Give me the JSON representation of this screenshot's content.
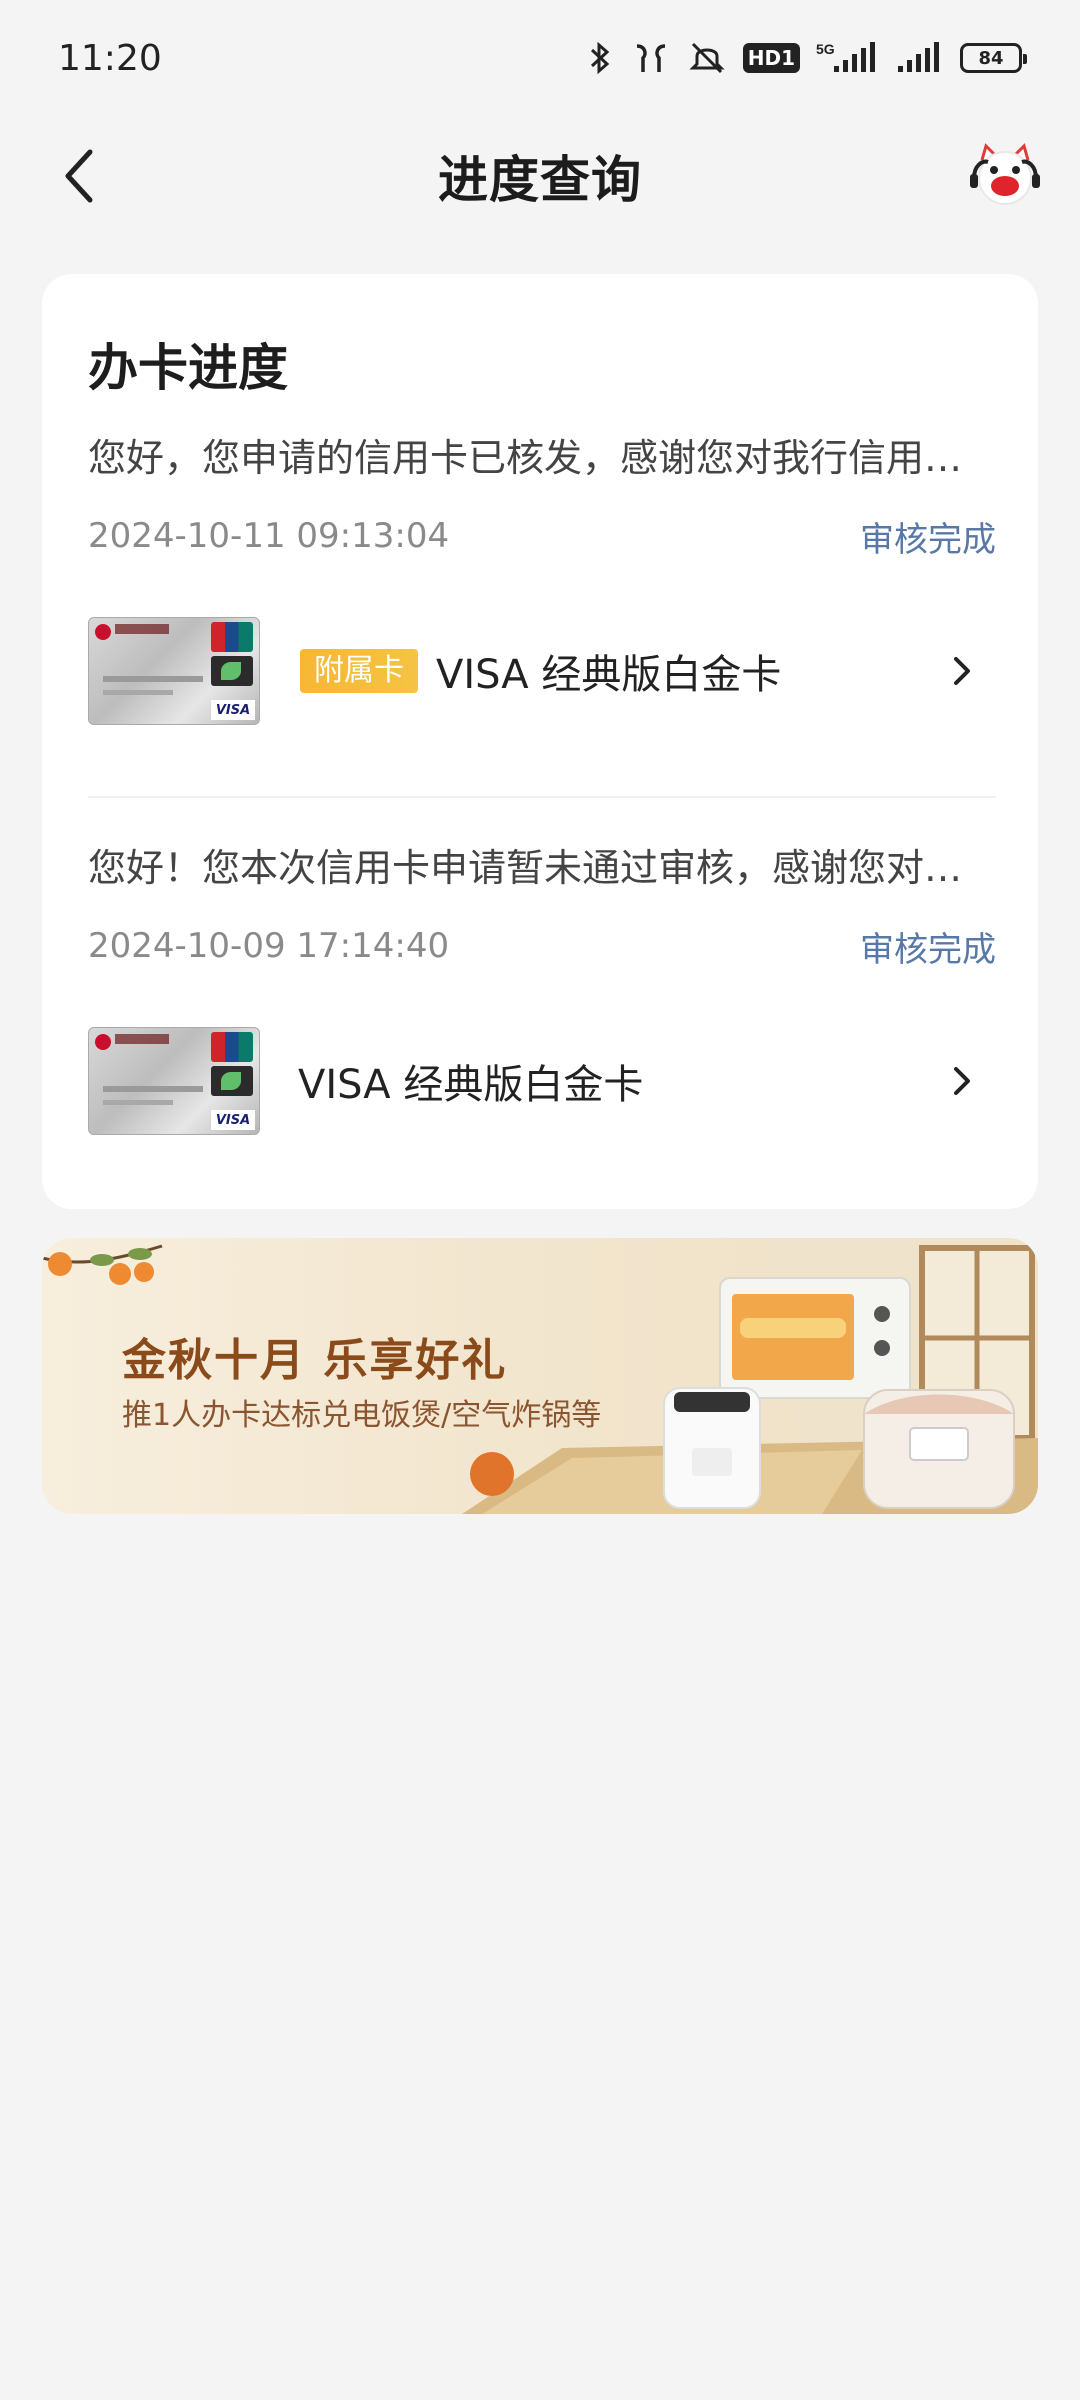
{
  "status_bar": {
    "time": "11:20",
    "network_badge": "HD1",
    "network_type": "5G",
    "battery": "84"
  },
  "header": {
    "title": "进度查询",
    "back_icon": "chevron-left-icon",
    "service_icon": "mascot-service-icon"
  },
  "progress": {
    "title": "办卡进度",
    "records": [
      {
        "message": "您好，您申请的信用卡已核发，感谢您对我行信用…",
        "date": "2024-10-11 09:13:04",
        "status": "审核完成",
        "badge": "附属卡",
        "product": "VISA 经典版白金卡"
      },
      {
        "message": "您好！您本次信用卡申请暂未通过审核，感谢您对…",
        "date": "2024-10-09 17:14:40",
        "status": "审核完成",
        "badge": "",
        "product": "VISA 经典版白金卡"
      }
    ]
  },
  "banner": {
    "title": "金秋十月  乐享好礼",
    "subtitle": "推1人办卡达标兑电饭煲/空气炸锅等"
  },
  "colors": {
    "background": "#f4f4f4",
    "status_text": "#5878a8",
    "badge": "#f5b935"
  }
}
